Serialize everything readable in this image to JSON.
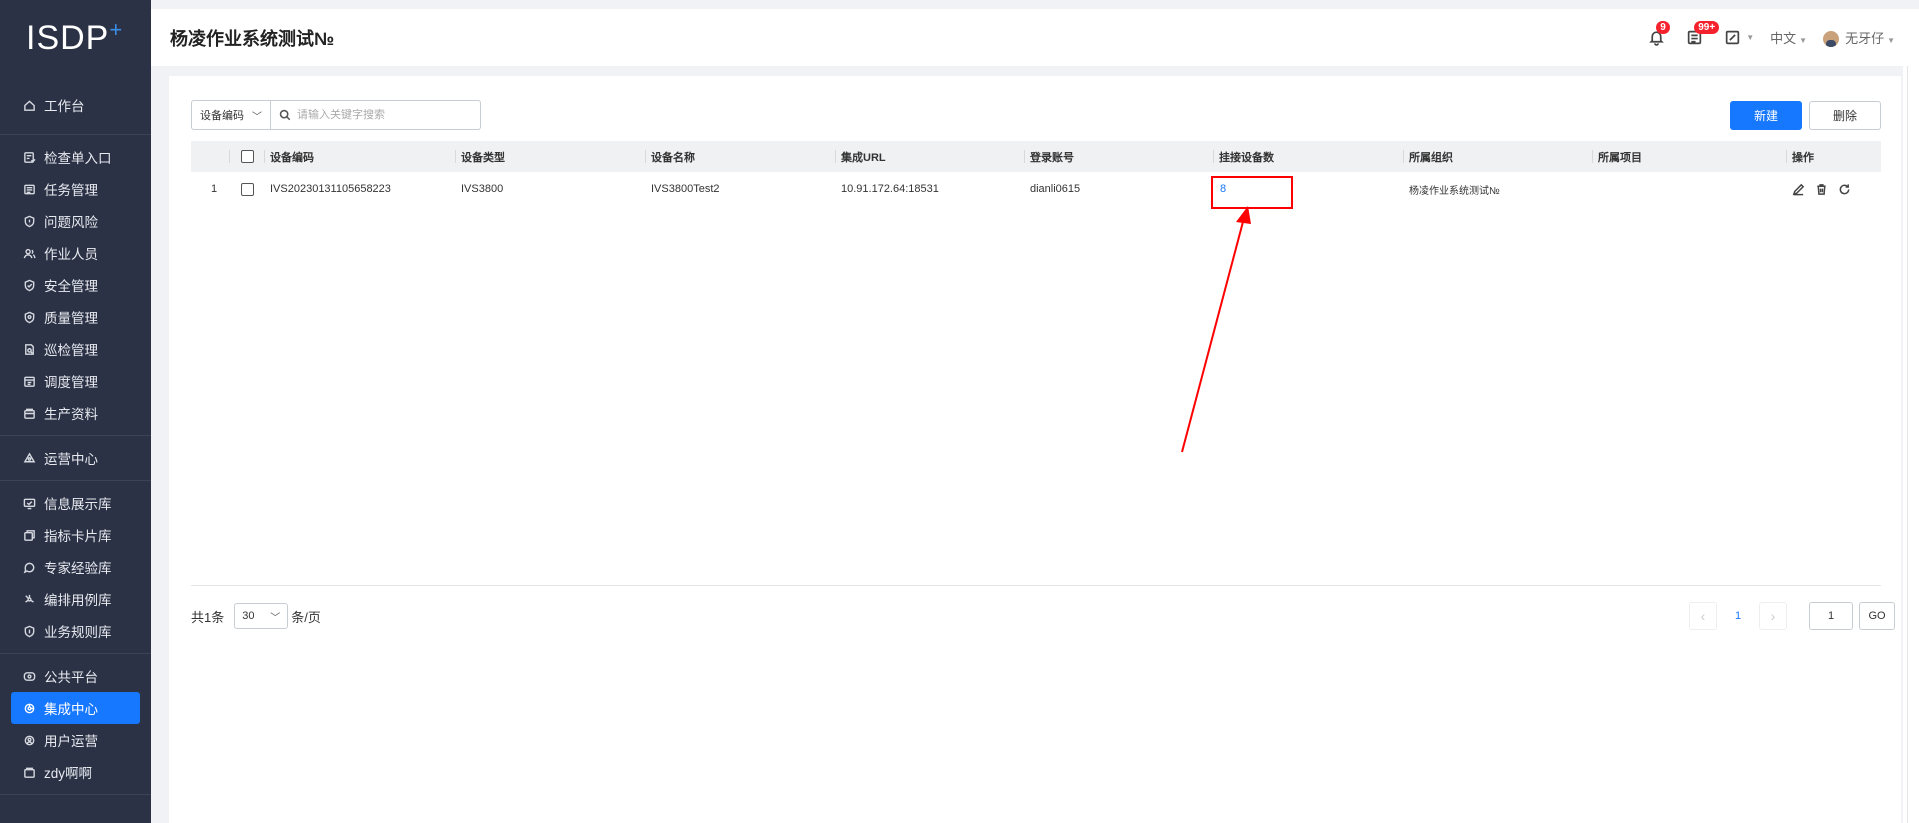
{
  "logo": {
    "text": "ISDP",
    "suffix": "+"
  },
  "sidebar": {
    "groups": [
      [
        {
          "label": "工作台",
          "icon": "home-icon"
        }
      ],
      [
        {
          "label": "检查单入口",
          "icon": "checklist-icon"
        },
        {
          "label": "任务管理",
          "icon": "task-icon"
        },
        {
          "label": "问题风险",
          "icon": "shield-alert-icon"
        },
        {
          "label": "作业人员",
          "icon": "users-icon"
        },
        {
          "label": "安全管理",
          "icon": "shield-check-icon"
        },
        {
          "label": "质量管理",
          "icon": "quality-icon"
        },
        {
          "label": "巡检管理",
          "icon": "inspection-icon"
        },
        {
          "label": "调度管理",
          "icon": "schedule-icon"
        },
        {
          "label": "生产资料",
          "icon": "materials-icon"
        }
      ],
      [
        {
          "label": "运营中心",
          "icon": "operation-icon"
        }
      ],
      [
        {
          "label": "信息展示库",
          "icon": "monitor-icon"
        },
        {
          "label": "指标卡片库",
          "icon": "card-icon"
        },
        {
          "label": "专家经验库",
          "icon": "chat-icon"
        },
        {
          "label": "编排用例库",
          "icon": "orchestrate-icon"
        },
        {
          "label": "业务规则库",
          "icon": "rule-icon"
        }
      ],
      [
        {
          "label": "公共平台",
          "icon": "platform-icon"
        },
        {
          "label": "集成中心",
          "icon": "integration-icon",
          "active": true
        },
        {
          "label": "用户运营",
          "icon": "user-ops-icon"
        },
        {
          "label": "zdy啊啊",
          "icon": "custom-icon"
        }
      ]
    ]
  },
  "header": {
    "title": "杨凌作业系统测试№",
    "notifications_badge": "9",
    "tasks_badge": "99+",
    "language": "中文",
    "username": "无牙仔"
  },
  "toolbar": {
    "filter_select": "设备编码",
    "search_placeholder": "请输入关键字搜索",
    "new_label": "新建",
    "delete_label": "删除"
  },
  "table": {
    "columns": [
      "设备编码",
      "设备类型",
      "设备名称",
      "集成URL",
      "登录账号",
      "挂接设备数",
      "所属组织",
      "所属项目",
      "操作"
    ],
    "rows": [
      {
        "index": "1",
        "code": "IVS20230131105658223",
        "type": "IVS3800",
        "name": "IVS3800Test2",
        "url": "10.91.172.64:18531",
        "account": "dianli0615",
        "device_count": "8",
        "org": "杨凌作业系统测试№",
        "project": ""
      }
    ]
  },
  "pagination": {
    "total_prefix": "共1条",
    "page_size": "30",
    "per_page_suffix": "条/页",
    "current_page": "1",
    "jump_value": "1",
    "go_label": "GO"
  },
  "colors": {
    "accent": "#1677ff",
    "sidebar_bg": "#2b3245",
    "annotation": "#ff0000"
  }
}
